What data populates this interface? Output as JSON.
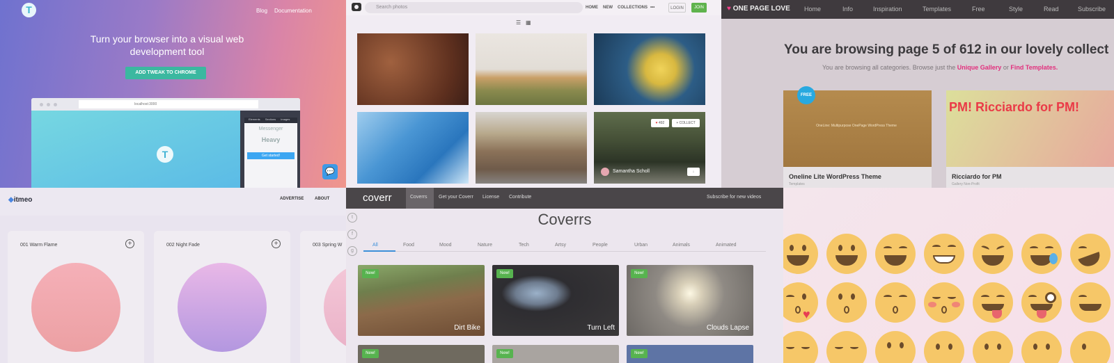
{
  "tweak": {
    "nav": [
      "Blog",
      "Documentation"
    ],
    "headline": "Turn your browser into a visual web development tool",
    "cta": "ADD TWEAK TO CHROME",
    "url": "localhost:3000",
    "panel_tabs": [
      "Elements",
      "Sections",
      "Images"
    ],
    "messenger": "Messenger",
    "heavy": "Heavy",
    "get_started": "Get started!"
  },
  "unsplash": {
    "search_placeholder": "Search photos",
    "nav": [
      "HOME",
      "NEW",
      "COLLECTIONS",
      "•••"
    ],
    "login": "LOGIN",
    "join": "JOIN",
    "likes": "492",
    "collect": "+ COLLECT",
    "author": "Samantha Scholl"
  },
  "onepagelove": {
    "logo": "ONE PAGE LOVE",
    "nav": [
      "Home",
      "Info",
      "Inspiration",
      "Templates",
      "Free",
      "Style",
      "Read",
      "Subscribe"
    ],
    "heading": "You are browsing page 5 of 612 in our lovely collect",
    "sub_prefix": "You are browsing all categories. Browse just the",
    "sub_link1": "Unique Gallery",
    "sub_or": "or",
    "sub_link2": "Find Templates.",
    "free_badge": "FREE",
    "card1_title": "Oneline Lite WordPress Theme",
    "card1_meta": "Templates",
    "card1_text": "OneLine: Multipurpose OnePage WordPress Theme",
    "card2_title": "Ricciardo for PM",
    "card2_meta": "Gallery  Non-Profit",
    "card2_banner": "PM! Ricciardo for PM!"
  },
  "itmeo": {
    "logo": "itmeo",
    "nav": [
      "ADVERTISE",
      "ABOUT"
    ],
    "cards": [
      {
        "name": "001 Warm Flame"
      },
      {
        "name": "002 Night Fade"
      },
      {
        "name": "003 Spring W"
      }
    ]
  },
  "coverr": {
    "logo": "coverr",
    "nav": [
      "Coverrs",
      "Get your Coverr",
      "License",
      "Contribute"
    ],
    "subscribe": "Subscribe for new videos",
    "title": "Coverrs",
    "tabs": [
      "All",
      "Food",
      "Mood",
      "Nature",
      "Tech",
      "Artsy",
      "People",
      "Urban",
      "Animals",
      "Animated"
    ],
    "new_badge": "New!",
    "tiles": [
      "Dirt Bike",
      "Turn Left",
      "Clouds Lapse"
    ]
  },
  "colors": {
    "tweak_accent": "#3bb8a0",
    "coverr_blue": "#3c8fd8",
    "opl_pink": "#e2307d"
  }
}
